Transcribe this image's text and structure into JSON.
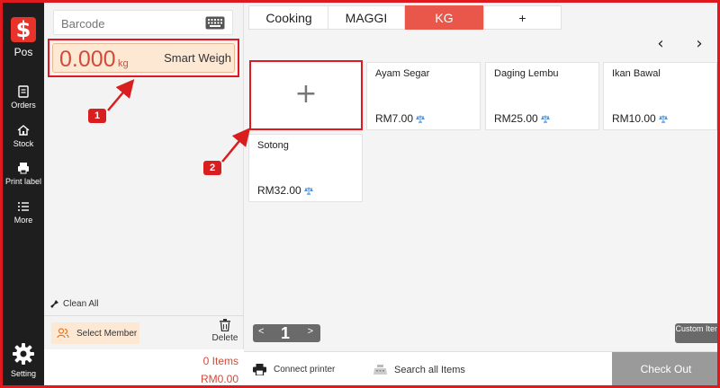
{
  "nav": {
    "logo": "$",
    "logo_label": "Pos",
    "items": [
      {
        "label": "Orders",
        "icon": "orders-icon"
      },
      {
        "label": "Stock",
        "icon": "stock-icon"
      },
      {
        "label": "Print label",
        "icon": "print-icon"
      },
      {
        "label": "More",
        "icon": "more-icon"
      }
    ],
    "setting_label": "Setting"
  },
  "cart": {
    "barcode_placeholder": "Barcode",
    "weight": "0.000",
    "unit": "kg",
    "smart_weigh": "Smart Weigh",
    "clean_all": "Clean All",
    "select_member": "Select Member",
    "delete": "Delete",
    "items_count": "0 Items",
    "total": "RM0.00"
  },
  "tabs": [
    {
      "label": "Cooking",
      "active": false
    },
    {
      "label": "MAGGI",
      "active": false
    },
    {
      "label": "KG",
      "active": true
    },
    {
      "label": "+",
      "active": false
    }
  ],
  "arrows": {
    "prev": "‹",
    "next": "›"
  },
  "add_tile": "+",
  "products": [
    {
      "name": "Ayam Segar",
      "price": "RM7.00"
    },
    {
      "name": "Daging Lembu",
      "price": "RM25.00"
    },
    {
      "name": "Ikan Bawal",
      "price": "RM10.00"
    },
    {
      "name": "Sotong",
      "price": "RM32.00"
    }
  ],
  "pager": {
    "prev": "<",
    "page": "1",
    "next": ">"
  },
  "custom_item": "Custom Item",
  "bottom": {
    "connect_printer": "Connect printer",
    "search_all": "Search all Items",
    "checkout": "Check Out"
  },
  "annotations": [
    {
      "label": "1"
    },
    {
      "label": "2"
    }
  ],
  "colors": {
    "accent": "#e9574a",
    "highlight": "#e0191e",
    "nav_bg": "#1e1e1e"
  }
}
